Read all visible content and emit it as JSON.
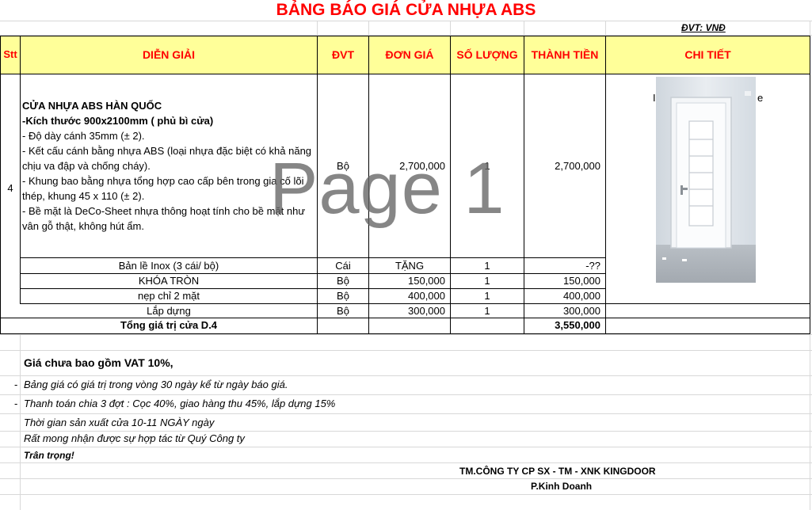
{
  "title": "BẢNG BÁO GIÁ CỬA NHỰA ABS",
  "unit_note": "ĐVT: VNĐ",
  "headers": {
    "stt": "Stt",
    "description": "DIỄN GIẢI",
    "unit": "ĐVT",
    "unit_price": "ĐƠN GIÁ",
    "quantity": "SỐ LƯỢNG",
    "amount": "THÀNH TIỀN",
    "detail": "CHI TIẾT"
  },
  "main_item": {
    "stt": "4",
    "lines": [
      {
        "text": "CỬA NHỰA ABS HÀN QUỐC",
        "bold": true
      },
      {
        "text": "-Kích thước 900x2100mm ( phủ bì cửa)",
        "bold": true
      },
      {
        "text": "- Độ dày cánh 35mm (± 2).",
        "bold": false
      },
      {
        "text": "- Kết cấu cánh bằng nhựa ABS (loại nhựa đặc biệt có khả năng chịu va đập và chống cháy).",
        "bold": false
      },
      {
        "text": "- Khung bao bằng nhựa tổng hợp cao cấp bên trong gia cố lõi thép, khung 45 x 110 (± 2).",
        "bold": false
      },
      {
        "text": "- Bề mặt là DeCo-Sheet nhựa thông hoạt tính cho bề mặt như vân gỗ thật, không hút ẩm.",
        "bold": false
      }
    ],
    "unit": "Bộ",
    "unit_price": "2,700,000",
    "quantity": "1",
    "amount": "2,700,000",
    "detail_text_left": "I",
    "detail_text_right": "e"
  },
  "sub_items": [
    {
      "name": "Bản lề Inox  (3 cái/ bộ)",
      "unit": "Cái",
      "unit_price": "TẶNG",
      "quantity": "1",
      "amount": "-??"
    },
    {
      "name": "KHÓA TRÒN",
      "unit": "Bộ",
      "unit_price": "150,000",
      "quantity": "1",
      "amount": "150,000"
    },
    {
      "name": "nẹp chỉ 2 mặt",
      "unit": "Bộ",
      "unit_price": "400,000",
      "quantity": "1",
      "amount": "400,000"
    },
    {
      "name": "Lắp dựng",
      "unit": "Bộ",
      "unit_price": "300,000",
      "quantity": "1",
      "amount": "300,000"
    }
  ],
  "total": {
    "label": "Tổng giá trị cửa D.4",
    "amount": "3,550,000"
  },
  "notes": {
    "vat": "Giá chưa bao gồm VAT 10%,",
    "validity_dash": "-",
    "validity": "Bảng giá có giá trị trong vòng 30 ngày kể từ ngày báo giá.",
    "payment_dash": "-",
    "payment": "Thanh toán chia 3 đợt : Cọc 40%, giao hàng thu 45%, lắp dựng 15%",
    "production": "Thời gian sản xuất cửa  10-11 NGÀY ngày",
    "cooperation": "Rất mong nhận được sự hợp tác từ Quý Công ty",
    "regards": "Trân trọng!"
  },
  "signature": {
    "company": "TM.CÔNG TY CP SX - TM - XNK KINGDOOR",
    "department": "P.Kinh Doanh"
  },
  "watermark": "Page 1",
  "colors": {
    "title": "#ff0000",
    "header_bg": "#ffff99",
    "grid": "#d8d8d8"
  }
}
